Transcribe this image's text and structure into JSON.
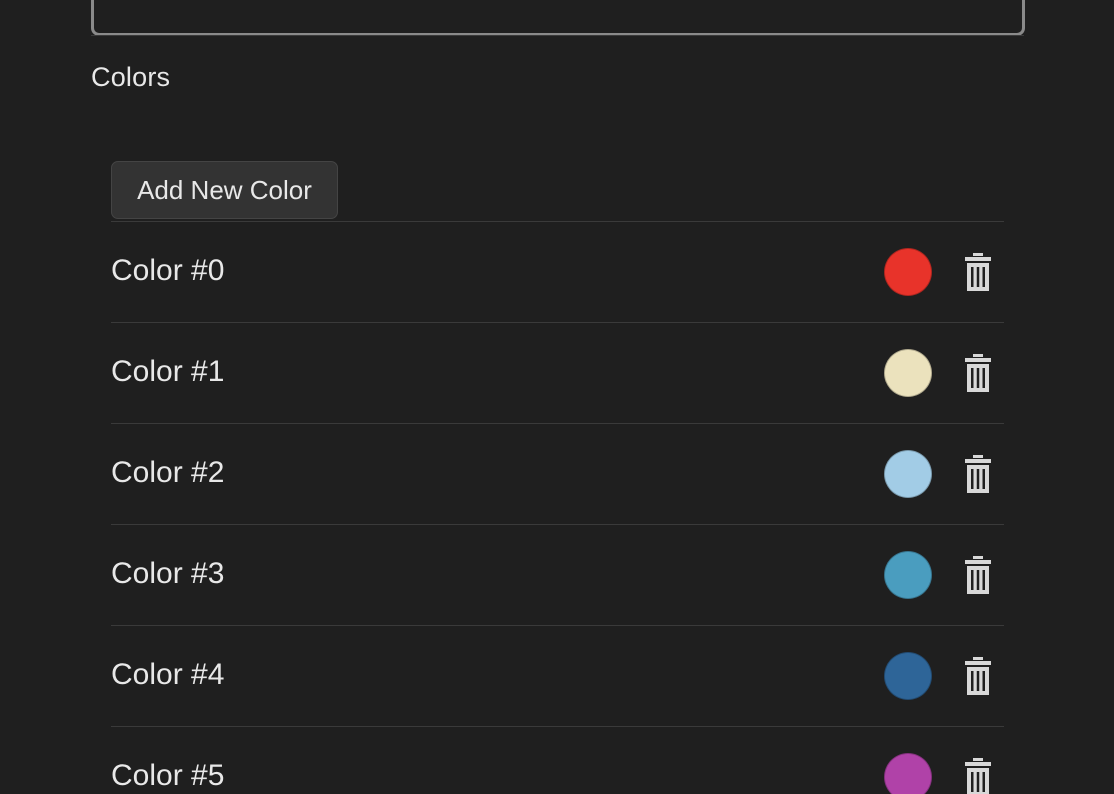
{
  "section": {
    "title": "Colors"
  },
  "toolbar": {
    "add_label": "Add New Color"
  },
  "colors": [
    {
      "label": "Color #0",
      "hex": "#e8332a"
    },
    {
      "label": "Color #1",
      "hex": "#ebe2bd"
    },
    {
      "label": "Color #2",
      "hex": "#a2cce6"
    },
    {
      "label": "Color #3",
      "hex": "#4a9dbf"
    },
    {
      "label": "Color #4",
      "hex": "#2e6598"
    },
    {
      "label": "Color #5",
      "hex": "#b042a8"
    }
  ],
  "icons": {
    "delete": "trash-icon"
  }
}
